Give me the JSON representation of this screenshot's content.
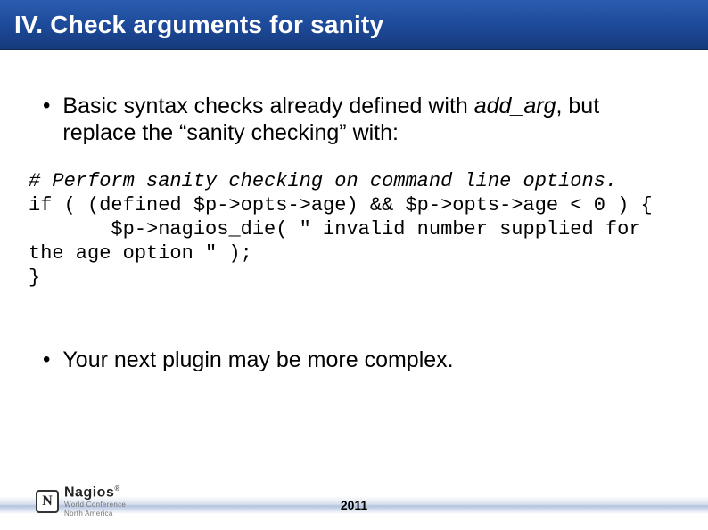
{
  "title": "IV. Check arguments for sanity",
  "bullets": {
    "b1_prefix": "Basic syntax checks already defined with ",
    "b1_emph": "add_arg",
    "b1_suffix": ", but replace the “sanity checking” with:",
    "b2": "Your next plugin may be more complex."
  },
  "code": {
    "comment": "# Perform sanity checking on command line options.",
    "line1": "if ( (defined $p->opts->age) && $p->opts->age < 0 ) {",
    "line2": "       $p->nagios_die( \" invalid number supplied for the age option \" );",
    "line3": "}"
  },
  "footer": {
    "year": "2011",
    "logo_name": "Nagios",
    "logo_sub": "World Conference",
    "logo_sub2": "North America",
    "reg": "®"
  }
}
